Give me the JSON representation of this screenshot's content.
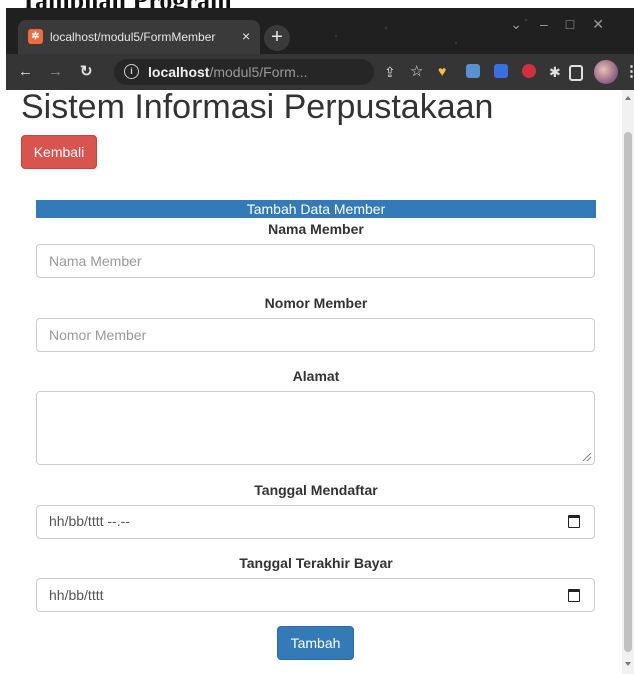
{
  "doc_caption": "Tampilan Program",
  "browser": {
    "tab_title": "localhost/modul5/FormMember",
    "tab_close": "×",
    "new_tab": "+",
    "url_host": "localhost",
    "url_path": "/modul5/Form...",
    "icons": [
      "back-icon",
      "forward-icon",
      "reload-icon",
      "info-icon",
      "share-icon",
      "star-icon",
      "extension-icons",
      "puzzle-icon",
      "sidepanel-icon",
      "avatar",
      "menu-icon"
    ]
  },
  "page": {
    "title": "Sistem Informasi Perpustakaan",
    "back_label": "Kembali",
    "panel_heading": "Tambah Data Member",
    "fields": {
      "nama": {
        "label": "Nama Member",
        "placeholder": "Nama Member",
        "value": ""
      },
      "nomor": {
        "label": "Nomor Member",
        "placeholder": "Nomor Member",
        "value": ""
      },
      "alamat": {
        "label": "Alamat",
        "value": ""
      },
      "tanggal_daftar": {
        "label": "Tanggal Mendaftar",
        "display": "hh/bb/tttt --.--"
      },
      "tanggal_bayar": {
        "label": "Tanggal Terakhir Bayar",
        "display": "hh/bb/tttt"
      }
    },
    "submit_label": "Tambah"
  },
  "colors": {
    "danger": "#d9534f",
    "primary": "#337ab7",
    "chrome_bg": "#202020"
  }
}
